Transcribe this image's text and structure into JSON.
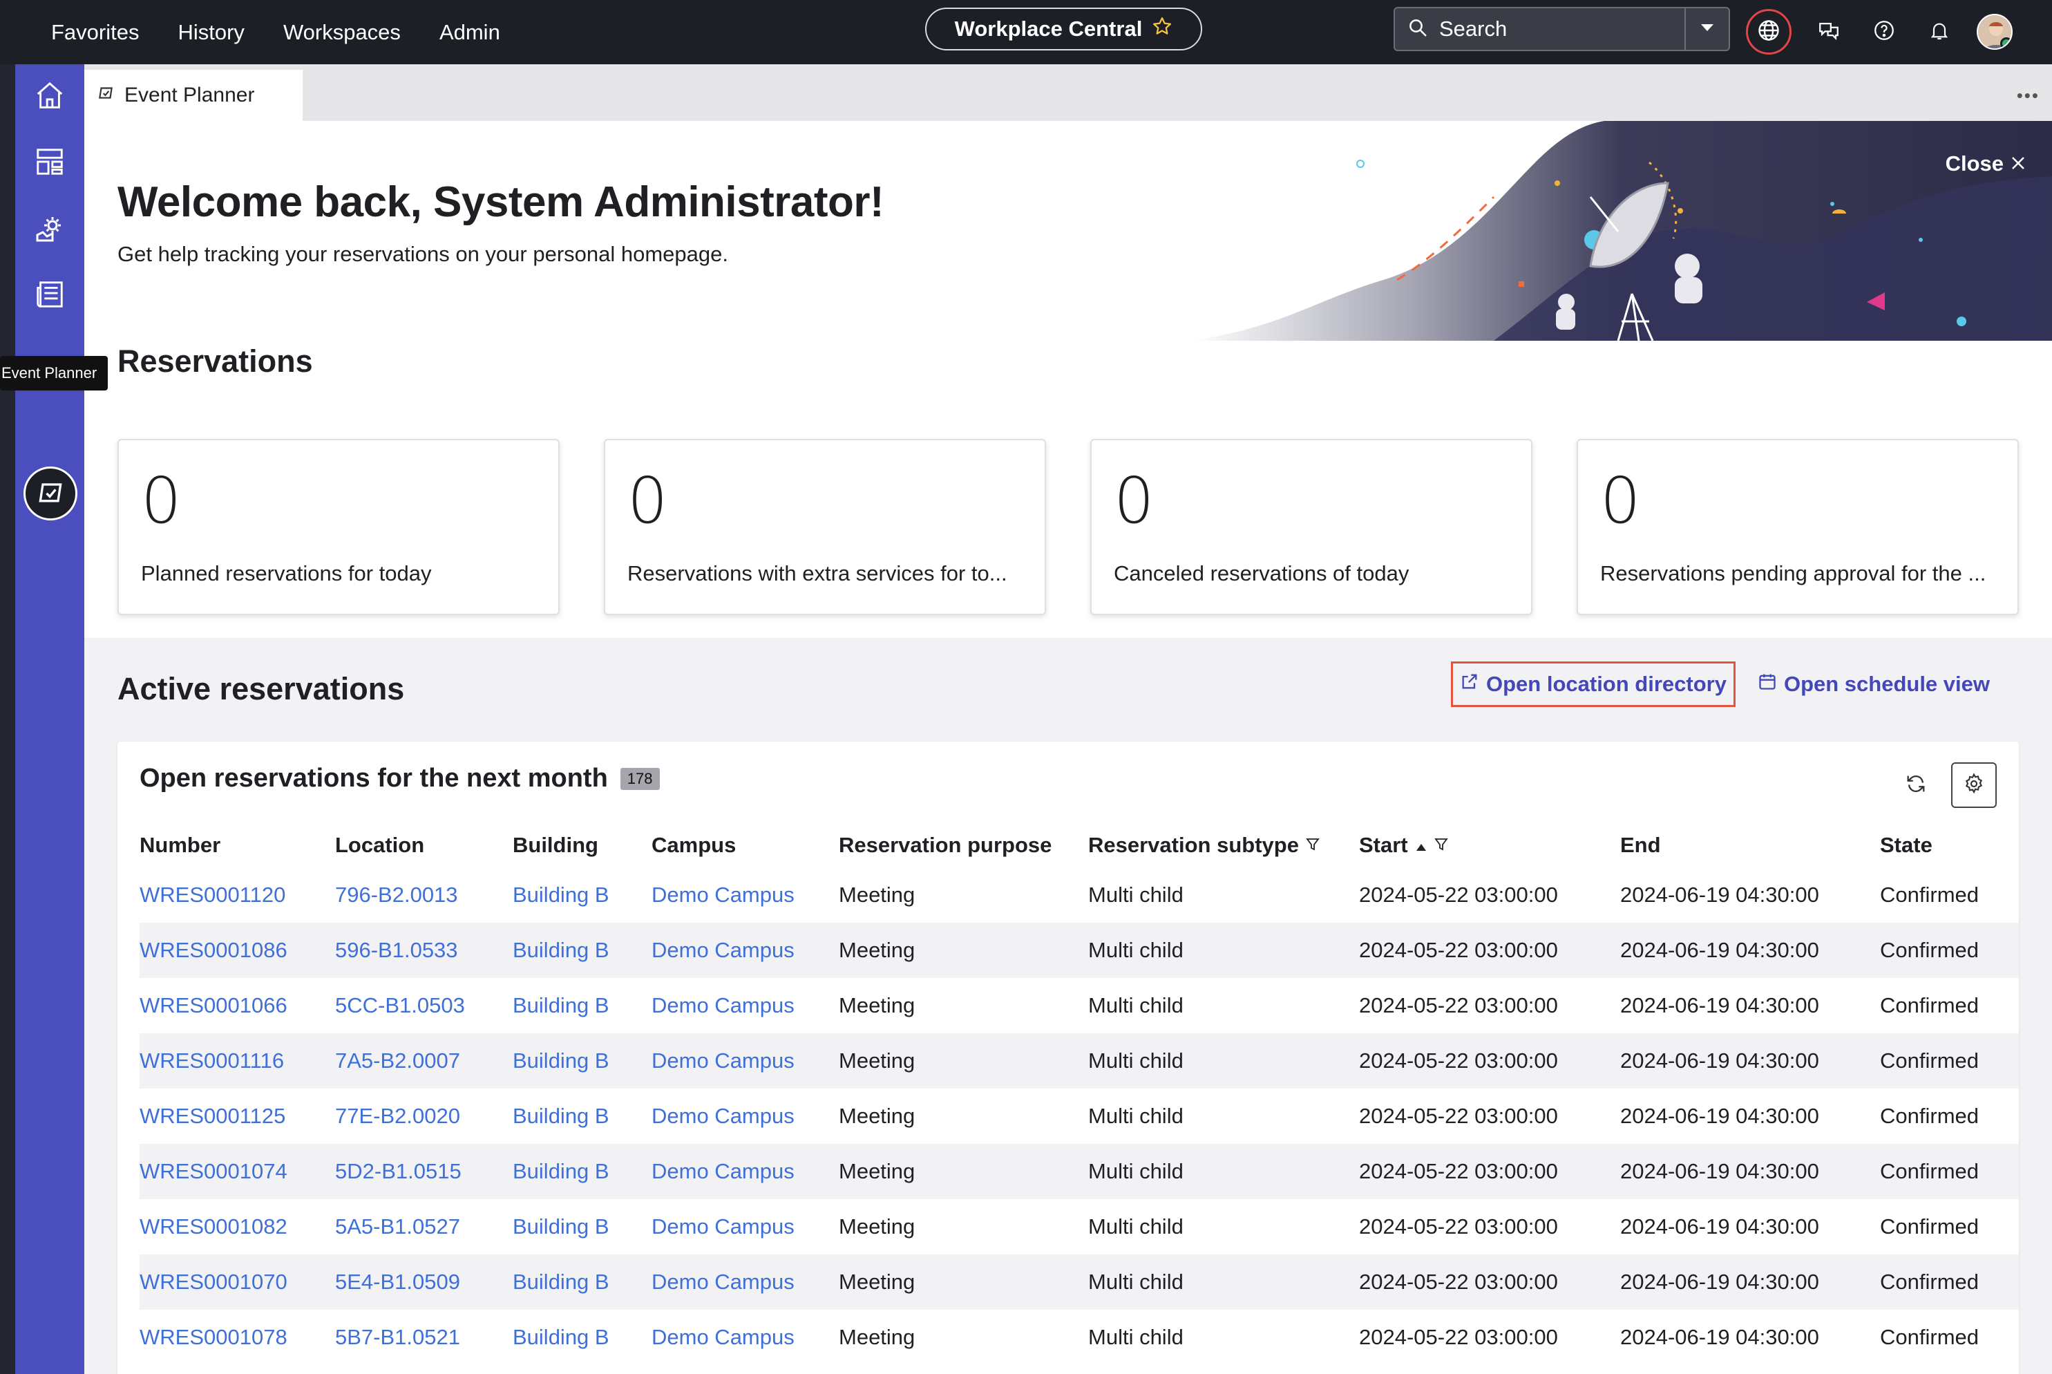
{
  "topnav": {
    "menu": [
      "Favorites",
      "History",
      "Workspaces",
      "Admin"
    ],
    "center_title": "Workplace Central",
    "search_placeholder": "Search"
  },
  "sidebar": {
    "tooltip": "Event Planner"
  },
  "tab": {
    "label": "Event Planner"
  },
  "hero": {
    "title": "Welcome back, System Administrator!",
    "subtitle": "Get help tracking your reservations on your personal homepage.",
    "close_label": "Close"
  },
  "reservations": {
    "title": "Reservations",
    "cards": [
      {
        "value": "0",
        "label": "Planned reservations for today"
      },
      {
        "value": "0",
        "label": "Reservations with extra services for to..."
      },
      {
        "value": "0",
        "label": "Canceled reservations of today"
      },
      {
        "value": "0",
        "label": "Reservations pending approval for the ..."
      }
    ]
  },
  "active": {
    "title": "Active reservations",
    "open_location": "Open location directory",
    "open_schedule": "Open schedule view",
    "table_title": "Open reservations for the next month",
    "count": "178",
    "columns": [
      "Number",
      "Location",
      "Building",
      "Campus",
      "Reservation purpose",
      "Reservation subtype",
      "Start",
      "End",
      "State"
    ],
    "rows": [
      [
        "WRES0001120",
        "796-B2.0013",
        "Building B",
        "Demo Campus",
        "Meeting",
        "Multi child",
        "2024-05-22 03:00:00",
        "2024-06-19 04:30:00",
        "Confirmed"
      ],
      [
        "WRES0001086",
        "596-B1.0533",
        "Building B",
        "Demo Campus",
        "Meeting",
        "Multi child",
        "2024-05-22 03:00:00",
        "2024-06-19 04:30:00",
        "Confirmed"
      ],
      [
        "WRES0001066",
        "5CC-B1.0503",
        "Building B",
        "Demo Campus",
        "Meeting",
        "Multi child",
        "2024-05-22 03:00:00",
        "2024-06-19 04:30:00",
        "Confirmed"
      ],
      [
        "WRES0001116",
        "7A5-B2.0007",
        "Building B",
        "Demo Campus",
        "Meeting",
        "Multi child",
        "2024-05-22 03:00:00",
        "2024-06-19 04:30:00",
        "Confirmed"
      ],
      [
        "WRES0001125",
        "77E-B2.0020",
        "Building B",
        "Demo Campus",
        "Meeting",
        "Multi child",
        "2024-05-22 03:00:00",
        "2024-06-19 04:30:00",
        "Confirmed"
      ],
      [
        "WRES0001074",
        "5D2-B1.0515",
        "Building B",
        "Demo Campus",
        "Meeting",
        "Multi child",
        "2024-05-22 03:00:00",
        "2024-06-19 04:30:00",
        "Confirmed"
      ],
      [
        "WRES0001082",
        "5A5-B1.0527",
        "Building B",
        "Demo Campus",
        "Meeting",
        "Multi child",
        "2024-05-22 03:00:00",
        "2024-06-19 04:30:00",
        "Confirmed"
      ],
      [
        "WRES0001070",
        "5E4-B1.0509",
        "Building B",
        "Demo Campus",
        "Meeting",
        "Multi child",
        "2024-05-22 03:00:00",
        "2024-06-19 04:30:00",
        "Confirmed"
      ],
      [
        "WRES0001078",
        "5B7-B1.0521",
        "Building B",
        "Demo Campus",
        "Meeting",
        "Multi child",
        "2024-05-22 03:00:00",
        "2024-06-19 04:30:00",
        "Confirmed"
      ]
    ]
  },
  "colors": {
    "nav_bg": "#1c1f26",
    "sidebar_bg": "#4b4fbd",
    "link": "#3f6fd8",
    "accent_link": "#4347b8",
    "highlight_border": "#e2553e"
  },
  "icons": {
    "sidebar": [
      "home-icon",
      "dashboard-icon",
      "gears-icon",
      "news-icon",
      "event-planner-icon"
    ],
    "top": [
      "globe-icon",
      "chat-icon",
      "help-icon",
      "bell-icon"
    ]
  }
}
